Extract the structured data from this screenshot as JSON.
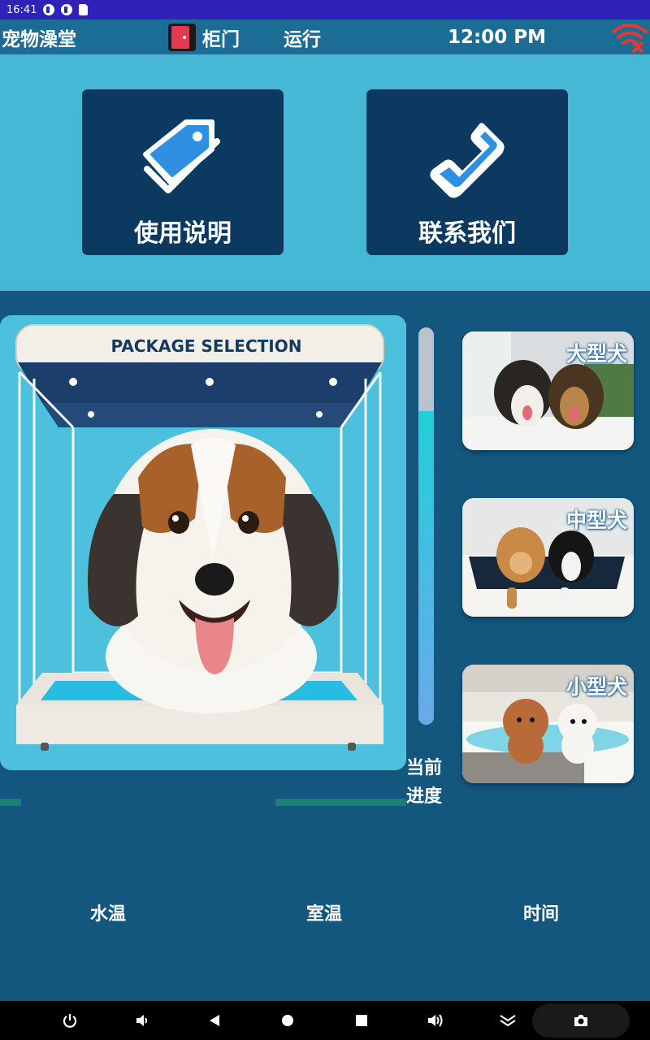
{
  "status_bar": {
    "time": "16:41"
  },
  "title_bar": {
    "app_title": "宠物澡堂",
    "door_label": "柜门",
    "status_label": "运行",
    "clock": "12:00 PM"
  },
  "buttons": {
    "manual": "使用说明",
    "contact": "联系我们"
  },
  "package": {
    "banner": "PACKAGE SELECTION"
  },
  "progress": {
    "label": "当前进度",
    "fraction": 0.79
  },
  "dog_sizes": [
    {
      "label": "大型犬"
    },
    {
      "label": "中型犬"
    },
    {
      "label": "小型犬"
    }
  ],
  "info": {
    "water_temp": "水温",
    "room_temp": "室温",
    "time": "时间"
  },
  "colors": {
    "status_bar": "#2e22b8",
    "title_bar": "#1b6d95",
    "top_panel": "#45b8d5",
    "button_bg": "#0c3960",
    "main_bg": "#13577f",
    "door_icon": "#e4394f",
    "wifi_off": "#e5392f",
    "progress_top": "#21d1d8",
    "progress_bottom": "#6aa9ea"
  }
}
